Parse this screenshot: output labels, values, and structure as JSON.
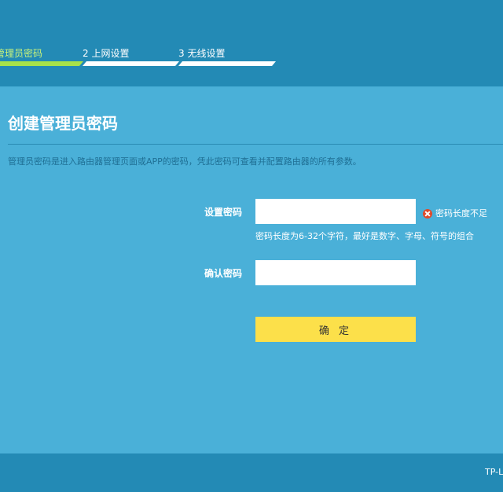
{
  "steps": [
    {
      "label": "管理员密码",
      "state": "active"
    },
    {
      "label": "2 上网设置",
      "state": "pending"
    },
    {
      "label": "3 无线设置",
      "state": "pending"
    }
  ],
  "page": {
    "title": "创建管理员密码",
    "description": "管理员密码是进入路由器管理页面或APP的密码，凭此密码可查看并配置路由器的所有参数。"
  },
  "form": {
    "password_label": "设置密码",
    "password_value": "",
    "password_error": "密码长度不足",
    "password_hint": "密码长度为6-32个字符，最好是数字、字母、符号的组合",
    "confirm_label": "确认密码",
    "confirm_value": "",
    "submit_label": "确 定"
  },
  "footer": {
    "brand": "TP-L"
  },
  "colors": {
    "header_bg": "#238ab5",
    "content_bg": "#4ab0d8",
    "active_step": "#a6e24a",
    "button_bg": "#fce04a",
    "error_icon": "#e04a2a"
  }
}
